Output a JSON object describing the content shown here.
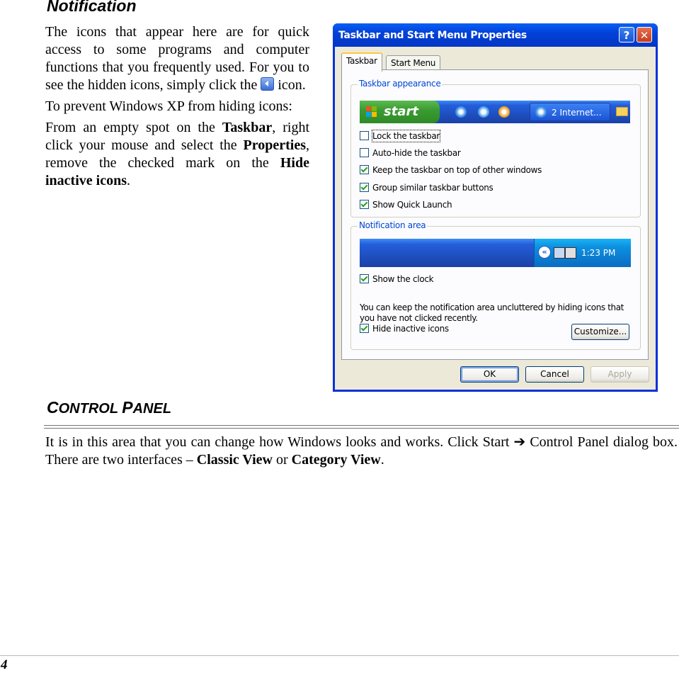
{
  "notification": {
    "heading": "Notification",
    "p1_before_icon": "The icons that appear here are for quick access to some programs and computer functions that you frequently used. For you to see the hidden icons, simply click the ",
    "p1_after_icon": " icon.",
    "p2": "To prevent Windows XP from hiding icons:",
    "p3_part1": "From an empty spot on the ",
    "p3_bold1": "Taskbar",
    "p3_part2": ", right click your mouse and select the ",
    "p3_bold2": "Properties",
    "p3_part3": ", remove the checked mark on the ",
    "p3_bold3": "Hide inactive icons",
    "p3_part4": "."
  },
  "dialog": {
    "title": "Taskbar and Start Menu Properties",
    "help_label": "?",
    "close_label": "✕",
    "tabs": [
      "Taskbar",
      "Start Menu"
    ],
    "appearance_group": "Taskbar appearance",
    "start_label": "start",
    "task_button_label": "2 Internet...",
    "appearance_options": [
      {
        "label": "Lock the taskbar",
        "checked": false
      },
      {
        "label": "Auto-hide the taskbar",
        "checked": false
      },
      {
        "label": "Keep the taskbar on top of other windows",
        "checked": true
      },
      {
        "label": "Group similar taskbar buttons",
        "checked": true
      },
      {
        "label": "Show Quick Launch",
        "checked": true
      }
    ],
    "notification_group": "Notification area",
    "clock_time": "1:23 PM",
    "show_clock": {
      "label": "Show the clock",
      "checked": true
    },
    "hint": "You can keep the notification area uncluttered by hiding icons that you have not clicked recently.",
    "hide_inactive": {
      "label": "Hide inactive icons",
      "checked": true
    },
    "customize_label": "Customize...",
    "ok_label": "OK",
    "cancel_label": "Cancel",
    "apply_label": "Apply"
  },
  "control_panel": {
    "heading_c": "C",
    "heading_rest1": "ONTROL ",
    "heading_p": "P",
    "heading_rest2": "ANEL",
    "text_part1": "It is in this area that you can change how Windows looks and works. Click Start ",
    "arrow": "➔",
    "text_part2": " Control Panel dialog box. There are two interfaces – ",
    "bold1": "Classic View",
    "text_part3": " or ",
    "bold2": "Category View",
    "text_part4": "."
  },
  "page_number": "4"
}
